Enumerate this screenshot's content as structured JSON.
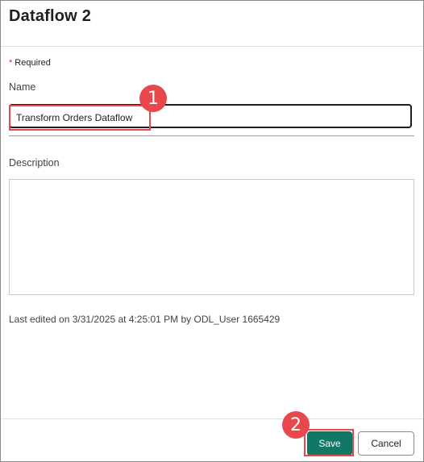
{
  "dialog": {
    "title": "Dataflow 2",
    "required_star": "*",
    "required_text": "Required",
    "name_label": "Name",
    "name_value": "Transform Orders Dataflow",
    "description_label": "Description",
    "description_value": "",
    "last_edited": "Last edited on 3/31/2025 at 4:25:01 PM by ODL_User 1665429"
  },
  "footer": {
    "save_label": "Save",
    "cancel_label": "Cancel"
  },
  "annotations": {
    "step1": "1",
    "step2": "2"
  },
  "colors": {
    "save_button": "#117865",
    "annotation": "#e8474c",
    "required_star": "#c4314b"
  }
}
